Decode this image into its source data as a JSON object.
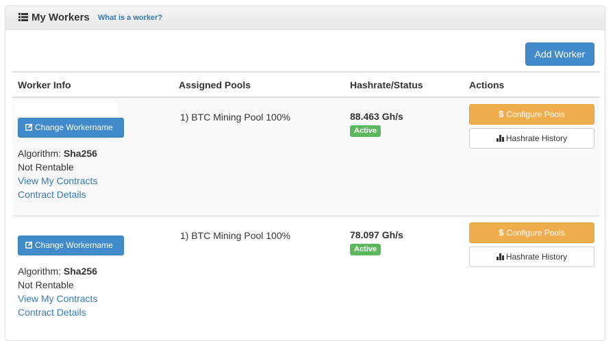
{
  "header": {
    "title": "My Workers",
    "help_link": "What is a worker?"
  },
  "add_worker_label": "Add Worker",
  "table": {
    "columns": [
      "Worker Info",
      "Assigned Pools",
      "Hashrate/Status",
      "Actions"
    ],
    "rows": [
      {
        "change_name_label": "Change Workername",
        "algorithm_label": "Algorithm:",
        "algorithm": "Sha256",
        "rentable": "Not Rentable",
        "view_contracts": "View My Contracts",
        "contract_details": "Contract Details",
        "pool": "1) BTC Mining Pool 100%",
        "hashrate": "88.463 Gh/s",
        "status": "Active",
        "configure_label": "Configure Pools",
        "history_label": "Hashrate History"
      },
      {
        "change_name_label": "Change Workername",
        "algorithm_label": "Algorithm:",
        "algorithm": "Sha256",
        "rentable": "Not Rentable",
        "view_contracts": "View My Contracts",
        "contract_details": "Contract Details",
        "pool": "1) BTC Mining Pool 100%",
        "hashrate": "78.097 Gh/s",
        "status": "Active",
        "configure_label": "Configure Pools",
        "history_label": "Hashrate History"
      }
    ]
  },
  "colors": {
    "primary": "#428bca",
    "warning": "#f0ad4e",
    "success": "#5cb85c",
    "link": "#337ab7"
  },
  "icons": [
    "list-icon",
    "edit-icon",
    "dollar-icon",
    "bar-chart-icon"
  ]
}
